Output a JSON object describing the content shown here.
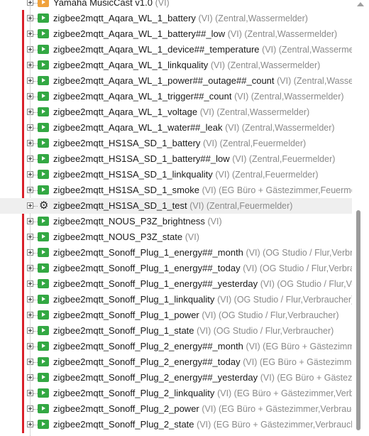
{
  "tree": {
    "items": [
      {
        "name": "Yamaha MusicCast v1.0",
        "meta": "(VI)",
        "icon": "orange-folder-icon"
      },
      {
        "name": "zigbee2mqtt_Aqara_WL_1_battery",
        "meta": "(VI) (Zentral,Wassermelder)",
        "icon": "green-script-icon"
      },
      {
        "name": "zigbee2mqtt_Aqara_WL_1_battery##_low",
        "meta": "(VI) (Zentral,Wassermelder)",
        "icon": "green-script-icon"
      },
      {
        "name": "zigbee2mqtt_Aqara_WL_1_device##_temperature",
        "meta": "(VI) (Zentral,Wassermelder)",
        "icon": "green-script-icon"
      },
      {
        "name": "zigbee2mqtt_Aqara_WL_1_linkquality",
        "meta": "(VI) (Zentral,Wassermelder)",
        "icon": "green-script-icon"
      },
      {
        "name": "zigbee2mqtt_Aqara_WL_1_power##_outage##_count",
        "meta": "(VI) (Zentral,Wassermelder)",
        "icon": "green-script-icon"
      },
      {
        "name": "zigbee2mqtt_Aqara_WL_1_trigger##_count",
        "meta": "(VI) (Zentral,Wassermelder)",
        "icon": "green-script-icon"
      },
      {
        "name": "zigbee2mqtt_Aqara_WL_1_voltage",
        "meta": "(VI) (Zentral,Wassermelder)",
        "icon": "green-script-icon"
      },
      {
        "name": "zigbee2mqtt_Aqara_WL_1_water##_leak",
        "meta": "(VI) (Zentral,Wassermelder)",
        "icon": "green-script-icon"
      },
      {
        "name": "zigbee2mqtt_HS1SA_SD_1_battery",
        "meta": "(VI) (Zentral,Feuermelder)",
        "icon": "green-script-icon"
      },
      {
        "name": "zigbee2mqtt_HS1SA_SD_1_battery##_low",
        "meta": "(VI) (Zentral,Feuermelder)",
        "icon": "green-script-icon"
      },
      {
        "name": "zigbee2mqtt_HS1SA_SD_1_linkquality",
        "meta": "(VI) (Zentral,Feuermelder)",
        "icon": "green-script-icon"
      },
      {
        "name": "zigbee2mqtt_HS1SA_SD_1_smoke",
        "meta": "(VI) (EG Büro + Gästezimmer,Feuermelder)",
        "icon": "green-script-icon"
      },
      {
        "name": "zigbee2mqtt_HS1SA_SD_1_test",
        "meta": "(VI) (Zentral,Feuermelder)",
        "icon": "gear-icon",
        "selected": true
      },
      {
        "name": "zigbee2mqtt_NOUS_P3Z_brightness",
        "meta": "(VI)",
        "icon": "green-script-icon"
      },
      {
        "name": "zigbee2mqtt_NOUS_P3Z_state",
        "meta": "(VI)",
        "icon": "green-script-icon"
      },
      {
        "name": "zigbee2mqtt_Sonoff_Plug_1_energy##_month",
        "meta": "(VI) (OG Studio / Flur,Verbraucher)",
        "icon": "green-script-icon"
      },
      {
        "name": "zigbee2mqtt_Sonoff_Plug_1_energy##_today",
        "meta": "(VI) (OG Studio / Flur,Verbraucher)",
        "icon": "green-script-icon"
      },
      {
        "name": "zigbee2mqtt_Sonoff_Plug_1_energy##_yesterday",
        "meta": "(VI) (OG Studio / Flur,Verbraucher)",
        "icon": "green-script-icon"
      },
      {
        "name": "zigbee2mqtt_Sonoff_Plug_1_linkquality",
        "meta": "(VI) (OG Studio / Flur,Verbraucher)",
        "icon": "green-script-icon"
      },
      {
        "name": "zigbee2mqtt_Sonoff_Plug_1_power",
        "meta": "(VI) (OG Studio / Flur,Verbraucher)",
        "icon": "green-script-icon"
      },
      {
        "name": "zigbee2mqtt_Sonoff_Plug_1_state",
        "meta": "(VI) (OG Studio / Flur,Verbraucher)",
        "icon": "green-script-icon"
      },
      {
        "name": "zigbee2mqtt_Sonoff_Plug_2_energy##_month",
        "meta": "(VI) (EG Büro + Gästezimmer,Verbraucher)",
        "icon": "green-script-icon"
      },
      {
        "name": "zigbee2mqtt_Sonoff_Plug_2_energy##_today",
        "meta": "(VI) (EG Büro + Gästezimmer,Verbraucher)",
        "icon": "green-script-icon"
      },
      {
        "name": "zigbee2mqtt_Sonoff_Plug_2_energy##_yesterday",
        "meta": "(VI) (EG Büro + Gästezimmer,Verbraucher)",
        "icon": "green-script-icon"
      },
      {
        "name": "zigbee2mqtt_Sonoff_Plug_2_linkquality",
        "meta": "(VI) (EG Büro + Gästezimmer,Verbraucher)",
        "icon": "green-script-icon"
      },
      {
        "name": "zigbee2mqtt_Sonoff_Plug_2_power",
        "meta": "(VI) (EG Büro + Gästezimmer,Verbraucher)",
        "icon": "green-script-icon"
      },
      {
        "name": "zigbee2mqtt_Sonoff_Plug_2_state",
        "meta": "(VI) (EG Büro + Gästezimmer,Verbraucher)",
        "icon": "green-script-icon"
      }
    ]
  },
  "colors": {
    "accent_bar": "#d9202a",
    "icon_green": "#33a843",
    "icon_orange": "#f0a23c",
    "selected_row": "#efefef"
  }
}
